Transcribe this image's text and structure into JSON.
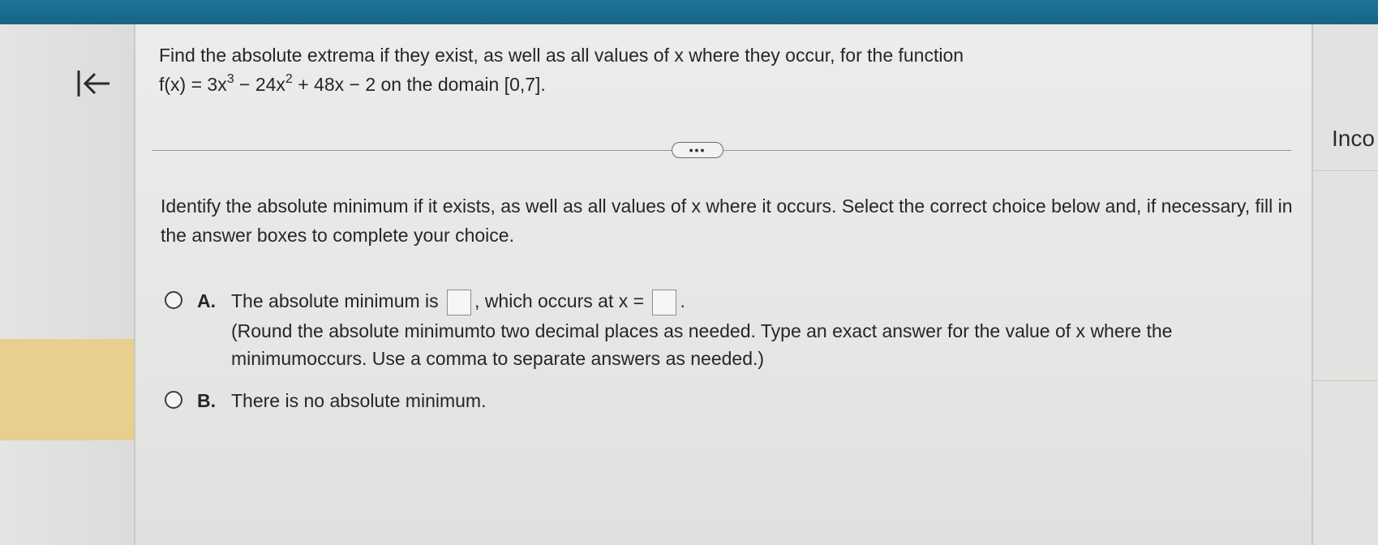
{
  "question": {
    "line1": "Find the absolute extrema if they exist, as well as all values of x where they occur, for the function",
    "function_parts": {
      "prefix": "f(x) = 3x",
      "exp1": "3",
      "mid": " − 24x",
      "exp2": "2",
      "suffix": " + 48x − 2 on the domain [0,7]."
    }
  },
  "expand_label": "•••",
  "instructions": "Identify the absolute minimum if it exists, as well as all values of x where it occurs. Select the correct choice below and, if necessary, fill in the answer boxes to complete your choice.",
  "choices": [
    {
      "letter": "A.",
      "text_before": "The absolute minimum is",
      "text_mid": ", which occurs at x =",
      "text_end": ".",
      "note": "(Round the absolute minimumto two decimal places as needed. Type an exact answer for the value of x where the minimumoccurs. Use a comma to separate answers as needed.)"
    },
    {
      "letter": "B.",
      "text": "There is no absolute minimum."
    }
  ],
  "side_panel": {
    "label": "Inco"
  },
  "colors": {
    "topbar": "#1f7297",
    "rail_highlight": "#e8cf8d"
  },
  "icons": {
    "back": "arrow-left-to-bar-icon"
  }
}
